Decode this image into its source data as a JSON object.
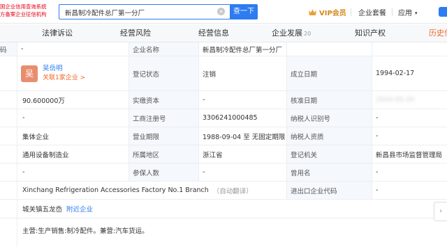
{
  "logo": {
    "line1": "国企业信用查询系统",
    "line2": "方备案企业征信机构"
  },
  "search": {
    "value": "新昌制冷配件总厂第一分厂",
    "button": "查一下",
    "clear_icon": "close-circle-icon"
  },
  "topnav": {
    "vip": "VIP会员",
    "vip_icon": "crown-icon",
    "taocan": "企业套餐",
    "apps": "应用",
    "apps_caret": "▾"
  },
  "tabs": [
    {
      "label": "法律诉讼",
      "count": ""
    },
    {
      "label": "经营风险",
      "count": ""
    },
    {
      "label": "经营信息",
      "count": ""
    },
    {
      "label": "企业发展",
      "count": "20"
    },
    {
      "label": "知识产权",
      "count": ""
    },
    {
      "label": "历史信",
      "count": ""
    }
  ],
  "rows": {
    "r0": {
      "c0": "码",
      "c1": "-",
      "l2": "企业名称",
      "v3": "新昌制冷配件总厂第一分厂"
    },
    "r1": {
      "avatar_char": "吴",
      "rep_name": "吴岳明",
      "rep_link": "关联1家企业 >",
      "l2": "登记状态",
      "v3": "注销",
      "l4": "成立日期",
      "v5": "1994-02-17"
    },
    "r2": {
      "c1": "90.600000万",
      "l2": "实缴资本",
      "v3": "-",
      "l4": "核准日期",
      "v5": "2020-05-20"
    },
    "r3": {
      "c1": "-",
      "l2": "工商注册号",
      "v3": "330624100048​5",
      "l4": "纳税人识别号",
      "v5": "-"
    },
    "r4": {
      "c1": "集体企业",
      "l2": "营业期限",
      "v3": "1988-09-04 至 无固定期限",
      "l4": "纳税人资质",
      "v5": "-"
    },
    "r5": {
      "c1": "通用设备制造业",
      "l2": "所属地区",
      "v3": "浙江省",
      "l4": "登记机关",
      "v5": "新昌县市场监督管理局"
    },
    "r6": {
      "c1": "-",
      "l2": "参保人数",
      "v3": "-",
      "l4": "曾用名",
      "v5": "-"
    },
    "r7": {
      "c1": "Xinchang Refrigeration Accessories Factory No.1 Branch",
      "c1_note": "（自动翻译）",
      "l4": "进出口企业代码",
      "v5": "-"
    },
    "r8": {
      "c1": "城关镇五龙岙",
      "c1_link": "附近企业"
    },
    "r9": {
      "c1": "主营:生产销售:制冷配件。兼营:汽车货运。"
    }
  },
  "side_arrow": "›"
}
